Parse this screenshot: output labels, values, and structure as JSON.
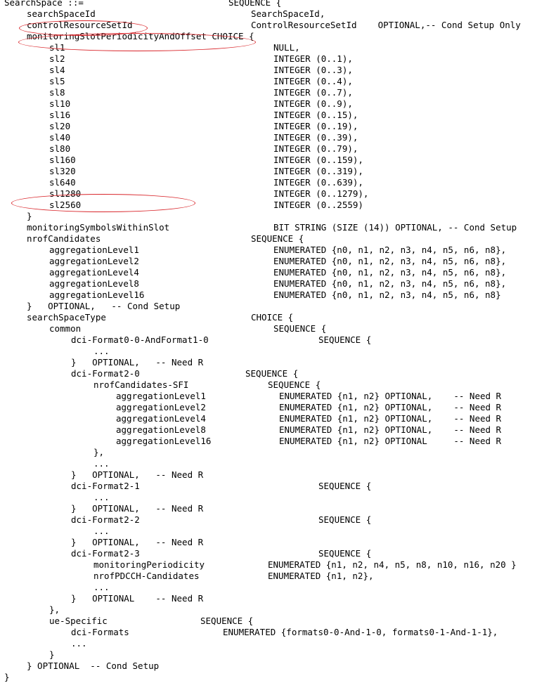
{
  "document": {
    "lines": [
      [
        "SearchSpace ::=",
        "SEQUENCE {"
      ],
      [
        "searchSpaceId",
        "SearchSpaceId,"
      ],
      [
        "controlResourceSetId",
        "ControlResourceSetId    OPTIONAL,-- Cond Setup Only"
      ],
      [
        "monitoringSlotPeriodicityAndOffset CHOICE {"
      ],
      [
        "sl1",
        "NULL,"
      ],
      [
        "sl2",
        "INTEGER (0..1),"
      ],
      [
        "sl4",
        "INTEGER (0..3),"
      ],
      [
        "sl5",
        "INTEGER (0..4),"
      ],
      [
        "sl8",
        "INTEGER (0..7),"
      ],
      [
        "sl10",
        "INTEGER (0..9),"
      ],
      [
        "sl16",
        "INTEGER (0..15),"
      ],
      [
        "sl20",
        "INTEGER (0..19),"
      ],
      [
        "sl40",
        "INTEGER (0..39),"
      ],
      [
        "sl80",
        "INTEGER (0..79),"
      ],
      [
        "sl160",
        "INTEGER (0..159),"
      ],
      [
        "sl320",
        "INTEGER (0..319),"
      ],
      [
        "sl640",
        "INTEGER (0..639),"
      ],
      [
        "sl1280",
        "INTEGER (0..1279),"
      ],
      [
        "sl2560",
        "INTEGER (0..2559)"
      ],
      [
        "}"
      ],
      [
        "monitoringSymbolsWithinSlot",
        "BIT STRING (SIZE (14)) OPTIONAL, -- Cond Setup"
      ],
      [
        "nrofCandidates",
        "SEQUENCE {"
      ],
      [
        "aggregationLevel1",
        "ENUMERATED {n0, n1, n2, n3, n4, n5, n6, n8},"
      ],
      [
        "aggregationLevel2",
        "ENUMERATED {n0, n1, n2, n3, n4, n5, n6, n8},"
      ],
      [
        "aggregationLevel4",
        "ENUMERATED {n0, n1, n2, n3, n4, n5, n6, n8},"
      ],
      [
        "aggregationLevel8",
        "ENUMERATED {n0, n1, n2, n3, n4, n5, n6, n8},"
      ],
      [
        "aggregationLevel16",
        "ENUMERATED {n0, n1, n2, n3, n4, n5, n6, n8}"
      ],
      [
        "}   OPTIONAL,   -- Cond Setup"
      ],
      [
        "searchSpaceType",
        "CHOICE {"
      ],
      [
        "common",
        "SEQUENCE {"
      ],
      [
        "dci-Format0-0-AndFormat1-0",
        "SEQUENCE {"
      ],
      [
        "..."
      ],
      [
        "}   OPTIONAL,   -- Need R"
      ],
      [
        "dci-Format2-0",
        "SEQUENCE {"
      ],
      [
        "nrofCandidates-SFI",
        "SEQUENCE {"
      ],
      [
        "aggregationLevel1",
        "ENUMERATED {n1, n2} OPTIONAL,    -- Need R"
      ],
      [
        "aggregationLevel2",
        "ENUMERATED {n1, n2} OPTIONAL,    -- Need R"
      ],
      [
        "aggregationLevel4",
        "ENUMERATED {n1, n2} OPTIONAL,    -- Need R"
      ],
      [
        "aggregationLevel8",
        "ENUMERATED {n1, n2} OPTIONAL,    -- Need R"
      ],
      [
        "aggregationLevel16",
        "ENUMERATED {n1, n2} OPTIONAL     -- Need R"
      ],
      [
        "},"
      ],
      [
        "..."
      ],
      [
        "}   OPTIONAL,   -- Need R"
      ],
      [
        "dci-Format2-1",
        "SEQUENCE {"
      ],
      [
        "..."
      ],
      [
        "}   OPTIONAL,   -- Need R"
      ],
      [
        "dci-Format2-2",
        "SEQUENCE {"
      ],
      [
        "..."
      ],
      [
        "}   OPTIONAL,   -- Need R"
      ],
      [
        "dci-Format2-3",
        "SEQUENCE {"
      ],
      [
        "monitoringPeriodicity",
        "ENUMERATED {n1, n2, n4, n5, n8, n10, n16, n20 }"
      ],
      [
        "nrofPDCCH-Candidates",
        "ENUMERATED {n1, n2},"
      ],
      [
        "..."
      ],
      [
        "}   OPTIONAL    -- Need R"
      ],
      [
        "},"
      ],
      [
        "ue-Specific",
        "SEQUENCE {"
      ],
      [
        "dci-Formats",
        "ENUMERATED {formats0-0-And-1-0, formats0-1-And-1-1},"
      ],
      [
        "..."
      ],
      [
        "}"
      ],
      [
        "} OPTIONAL  -- Cond Setup"
      ],
      [
        "}"
      ]
    ]
  },
  "annotations": {
    "highlight_color": "#d9262b"
  }
}
